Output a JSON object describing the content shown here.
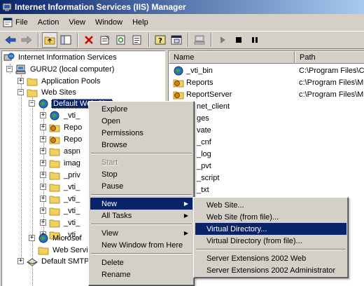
{
  "window": {
    "title": "Internet Information Services (IIS) Manager"
  },
  "menubar": {
    "items": [
      "File",
      "Action",
      "View",
      "Window",
      "Help"
    ]
  },
  "toolbar": {
    "buttons": [
      "back-icon",
      "forward-icon",
      "up-folder-icon",
      "show-hide-tree-icon",
      "delete-icon",
      "properties-icon",
      "refresh-icon",
      "export-icon",
      "help-icon",
      "new-window-icon",
      "computer-icon",
      "play-icon",
      "stop-icon",
      "pause-icon"
    ]
  },
  "tree": {
    "root": "Internet Information Services",
    "computer": "GURU2 (local computer)",
    "app_pools": "Application Pools",
    "web_sites": "Web Sites",
    "default_site": "Default Web Site",
    "children": [
      "_vti_",
      "Repo",
      "Repo",
      "aspn",
      "imag",
      "_priv",
      "_vti_",
      "_vti_",
      "_vti_",
      "_vti_",
      "_vti_"
    ],
    "microsoft": "Microsof",
    "web_service": "Web Service",
    "smtp": "Default SMTP"
  },
  "list": {
    "headers": {
      "name": "Name",
      "path": "Path"
    },
    "rows": [
      {
        "name": "_vti_bin",
        "path": "C:\\Program Files\\Co",
        "icon": "globe-icon"
      },
      {
        "name": "Reports",
        "path": "c:\\Program Files\\Mic",
        "icon": "gear-folder-icon"
      },
      {
        "name": "ReportServer",
        "path": "c:\\Program Files\\Mic",
        "icon": "gear-folder-icon"
      },
      {
        "name": "net_client",
        "path": ""
      },
      {
        "name": "ges",
        "path": ""
      },
      {
        "name": "vate",
        "path": ""
      },
      {
        "name": "_cnf",
        "path": ""
      },
      {
        "name": "_log",
        "path": ""
      },
      {
        "name": "_pvt",
        "path": ""
      },
      {
        "name": "_script",
        "path": ""
      },
      {
        "name": "_txt",
        "path": ""
      }
    ]
  },
  "context_menu": {
    "explore": "Explore",
    "open": "Open",
    "permissions": "Permissions",
    "browse": "Browse",
    "start": "Start",
    "stop": "Stop",
    "pause": "Pause",
    "new": "New",
    "all_tasks": "All Tasks",
    "view": "View",
    "new_window": "New Window from Here",
    "delete": "Delete",
    "rename": "Rename"
  },
  "submenu": {
    "web_site": "Web Site...",
    "web_site_file": "Web Site (from file)...",
    "virtual_directory": "Virtual Directory...",
    "virtual_directory_file": "Virtual Directory (from file)...",
    "server_ext_web": "Server Extensions 2002 Web",
    "server_ext_admin": "Server Extensions 2002 Administrator"
  },
  "colors": {
    "selection": "#0a246a",
    "face": "#d4d0c8"
  }
}
